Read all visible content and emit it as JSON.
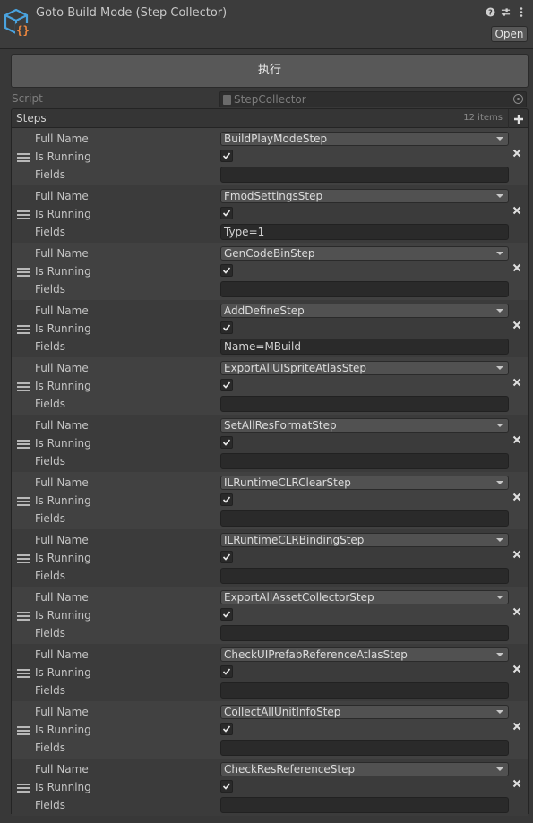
{
  "header": {
    "title": "Goto Build Mode (Step Collector)",
    "open_label": "Open",
    "icons": [
      "help-icon",
      "preset-icon",
      "more-icon"
    ]
  },
  "execute_label": "执行",
  "script": {
    "label": "Script",
    "value": "StepCollector"
  },
  "steps": {
    "label": "Steps",
    "count": "12 items",
    "field_labels": {
      "full_name": "Full Name",
      "is_running": "Is Running",
      "fields": "Fields"
    },
    "items": [
      {
        "full_name": "BuildPlayModeStep",
        "is_running": true,
        "fields": ""
      },
      {
        "full_name": "FmodSettingsStep",
        "is_running": true,
        "fields": "Type=1"
      },
      {
        "full_name": "GenCodeBinStep",
        "is_running": true,
        "fields": ""
      },
      {
        "full_name": "AddDefineStep",
        "is_running": true,
        "fields": "Name=MBuild"
      },
      {
        "full_name": "ExportAllUISpriteAtlasStep",
        "is_running": true,
        "fields": ""
      },
      {
        "full_name": "SetAllResFormatStep",
        "is_running": true,
        "fields": ""
      },
      {
        "full_name": "ILRuntimeCLRClearStep",
        "is_running": true,
        "fields": ""
      },
      {
        "full_name": "ILRuntimeCLRBindingStep",
        "is_running": true,
        "fields": ""
      },
      {
        "full_name": "ExportAllAssetCollectorStep",
        "is_running": true,
        "fields": ""
      },
      {
        "full_name": "CheckUIPrefabReferenceAtlasStep",
        "is_running": true,
        "fields": ""
      },
      {
        "full_name": "CollectAllUnitInfoStep",
        "is_running": true,
        "fields": ""
      },
      {
        "full_name": "CheckResReferenceStep",
        "is_running": true,
        "fields": ""
      }
    ]
  },
  "colors": {
    "background": "#383838",
    "button": "#585858",
    "field": "#2a2a2a",
    "logo_blue": "#4aa3df",
    "logo_orange": "#f0883e"
  }
}
